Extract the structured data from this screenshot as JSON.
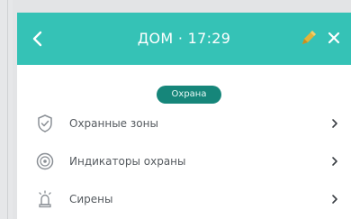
{
  "header": {
    "title": "ДОМ · 17:29",
    "back_icon": "chevron-left-icon",
    "edit_icon": "pencil-icon",
    "close_icon": "close-icon"
  },
  "status": {
    "label": "Охрана"
  },
  "menu": {
    "items": [
      {
        "label": "Охранные зоны",
        "icon": "shield-check-icon"
      },
      {
        "label": "Индикаторы охраны",
        "icon": "indicator-icon"
      },
      {
        "label": "Сирены",
        "icon": "siren-icon"
      }
    ]
  },
  "colors": {
    "appbar": "#35c2b6",
    "badge": "#16867a",
    "edit_icon": "#e2b43a"
  }
}
